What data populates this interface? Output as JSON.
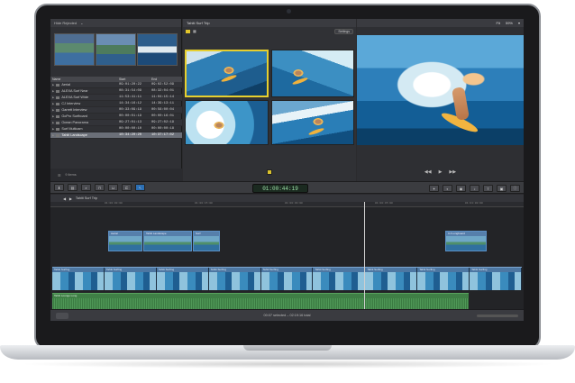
{
  "library": {
    "header_label": "Hide Rejected",
    "columns": [
      "Name",
      "Start",
      "End"
    ],
    "clips": [
      {
        "name": "Aerial",
        "start": "09:01:20:22",
        "end": "09:02:52:09"
      },
      {
        "name": "ALEXA Surf Near",
        "start": "08:31:54:09",
        "end": "08:32:04:01"
      },
      {
        "name": "ALEXA Surf Wide",
        "start": "11:53:41:11",
        "end": "11:04:15:14"
      },
      {
        "name": "CJ Interview",
        "start": "14:34:16:12",
        "end": "14:39:13:11"
      },
      {
        "name": "Garrett Interview",
        "start": "00:33:09:19",
        "end": "00:56:00:04"
      },
      {
        "name": "GoPro Surfboard",
        "start": "00:00:01:19",
        "end": "00:00:16:01"
      },
      {
        "name": "Ocean Panorama",
        "start": "09:27:01:13",
        "end": "09:27:02:19"
      },
      {
        "name": "Surf Multicam",
        "start": "00:00:00:10",
        "end": "00:00:00:18"
      },
      {
        "name": "Tahiti Landscape",
        "start": "10:34:20:20",
        "end": "10:37:17:02"
      }
    ],
    "selected_index": 8,
    "footer_label": "9 items"
  },
  "event": {
    "title": "Tahiti Surf Trip",
    "settings_label": "Settings"
  },
  "viewer": {
    "fit_label": "Fit",
    "zoom_label": "59%"
  },
  "toolbar": {
    "timecode": "01:00:44:19"
  },
  "timeline": {
    "project_name": "Tahiti Surf Trip",
    "ruler_ticks": [
      "01:00:00:00",
      "01:00:15:00",
      "01:00:30:00",
      "01:00:45:00",
      "01:01:00:00"
    ],
    "connected_clips": [
      {
        "label": "Aerial"
      },
      {
        "label": "Tahiti Landscape"
      },
      {
        "label": "Surf"
      },
      {
        "label": "CJ Longboard"
      }
    ],
    "storyline": [
      "Tahiti Surfing",
      "Tahiti Surfing",
      "Tahiti Surfing",
      "Tahiti Surfing",
      "Tahiti Surfing",
      "Tahiti Surfing",
      "Tahiti Surfing",
      "Tahiti Surfing",
      "Tahiti Surfing"
    ],
    "audio_label": "Tahiti Lounge Long"
  },
  "status": {
    "text": "00:07 selected – 02:19:16 total"
  },
  "colors": {
    "accent_selection": "#e7cf2e",
    "timecode_text": "#9ee3a9",
    "video_clip": "#3a5d84",
    "audio_clip": "#2f6b37"
  }
}
